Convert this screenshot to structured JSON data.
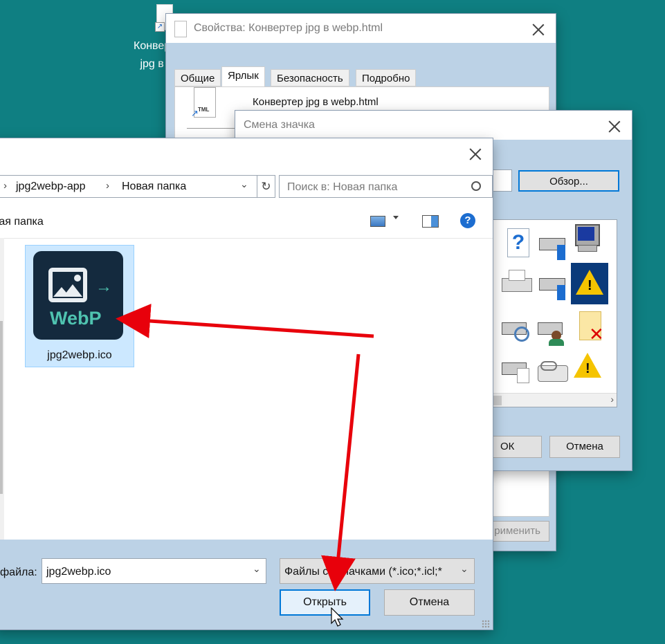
{
  "desktop": {
    "icon_label_line1": "Конвер",
    "icon_label_line2": "jpg в"
  },
  "properties_dialog": {
    "title": "Свойства: Конвертер jpg в webp.html",
    "tabs": [
      "Общие",
      "Ярлык",
      "Безопасность",
      "Подробно"
    ],
    "file_name": "Конвертер jpg в webp.html",
    "file_icon_text": "TML",
    "apply_label": "рименить"
  },
  "change_icon_dialog": {
    "title": "Смена значка",
    "browse_label": "Обзор...",
    "ok_label": "ОК",
    "cancel_label": "Отмена"
  },
  "open_dialog": {
    "breadcrumb": [
      "jpg2webp-app",
      "Новая папка"
    ],
    "search_placeholder": "Поиск в: Новая папка",
    "folder_label": "вая папка",
    "file": {
      "name": "jpg2webp.ico",
      "icon_text": "WebP"
    },
    "filename_label": "файла:",
    "filename_value": "jpg2webp.ico",
    "filter_label": "Файлы со значками (*.ico;*.icl;*",
    "open_label": "Открыть",
    "cancel_label": "Отмена",
    "help_glyph": "?"
  },
  "colors": {
    "desktop": "#0f7f82",
    "dialog_panel": "#bcd2e6",
    "selection": "#cce8ff",
    "arrow": "#e8000b",
    "accent": "#0078d7"
  }
}
